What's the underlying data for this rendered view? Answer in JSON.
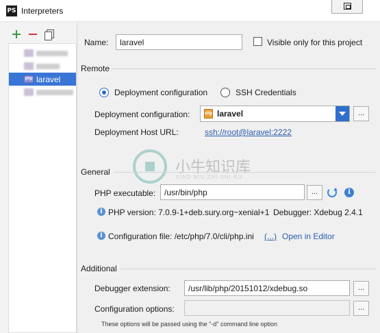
{
  "window": {
    "title": "Interpreters",
    "app_icon_text": "PS"
  },
  "toolbar": {
    "add_icon": "plus-icon",
    "remove_icon": "minus-icon",
    "copy_icon": "copy-icon"
  },
  "tree": {
    "selected_label": "laravel",
    "selected_icon_text": "php"
  },
  "name": {
    "label": "Name:",
    "value": "laravel"
  },
  "visible_only": {
    "label": "Visible only for this project",
    "checked": false
  },
  "remote": {
    "section_title": "Remote",
    "deployment_radio": "Deployment configuration",
    "ssh_radio": "SSH Credentials",
    "deployment_label": "Deployment configuration:",
    "deployment_value": "laravel",
    "deployment_icon_text": "sftp",
    "host_label": "Deployment Host URL:",
    "host_value": "ssh://root@laravel:2222"
  },
  "general": {
    "section_title": "General",
    "php_exec_label": "PHP executable:",
    "php_exec_value": "/usr/bin/php",
    "php_version_text": "PHP version: 7.0.9-1+deb.sury.org~xenial+1",
    "debugger_text": "Debugger:  Xdebug 2.4.1",
    "config_file_text": "Configuration file: /etc/php/7.0/cli/php.ini",
    "config_file_link": "(...)",
    "open_in_editor": "Open in Editor"
  },
  "additional": {
    "section_title": "Additional",
    "debugger_ext_label": "Debugger extension:",
    "debugger_ext_value": "/usr/lib/php/20151012/xdebug.so",
    "config_options_label": "Configuration options:",
    "config_options_value": "",
    "hint": "These options will be passed using the \"-d\" command line option"
  },
  "ellipsis": "...",
  "watermark": {
    "title": "小牛知识库",
    "subtitle": "XIAO NIU ZHI SHI KU"
  }
}
